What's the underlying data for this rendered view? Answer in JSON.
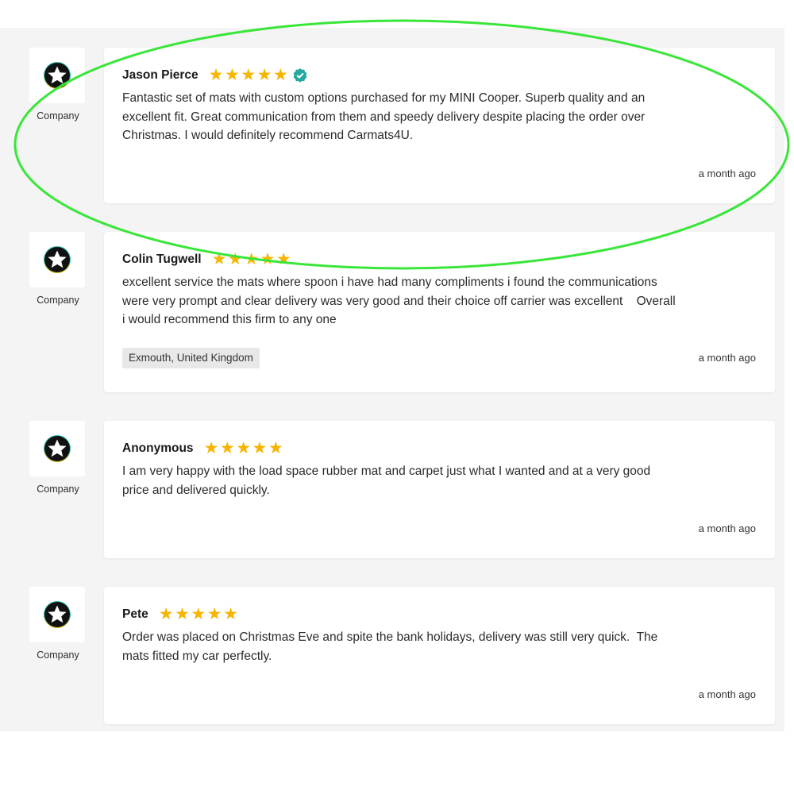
{
  "theme": {
    "star_color": "#f7b500",
    "verified_color": "#25a89e",
    "annotation_color": "#39e639"
  },
  "reviews": [
    {
      "company_label": "Company",
      "author": "Jason Pierce",
      "rating": 5,
      "verified": true,
      "text_lines": [
        "Fantastic set of mats with custom options purchased for my MINI Cooper. Superb quality and an",
        "excellent fit. Great communication from them and speedy delivery despite placing the order over",
        "Christmas. I would definitely recommend Carmats4U."
      ],
      "location": "",
      "date": "a month ago"
    },
    {
      "company_label": "Company",
      "author": "Colin Tugwell",
      "rating": 5,
      "verified": false,
      "text_lines": [
        "excellent service the mats where spoon i have had many compliments i found the communications",
        "were very prompt and clear delivery was very good and their choice off carrier was excellent    Overall",
        "i would recommend this firm to any one"
      ],
      "location": "Exmouth, United Kingdom",
      "date": "a month ago"
    },
    {
      "company_label": "Company",
      "author": "Anonymous",
      "rating": 5,
      "verified": false,
      "text_lines": [
        "I am very happy with the load space rubber mat and carpet just what I wanted and at a very good",
        "price and delivered quickly."
      ],
      "location": "",
      "date": "a month ago"
    },
    {
      "company_label": "Company",
      "author": "Pete",
      "rating": 5,
      "verified": false,
      "text_lines": [
        "Order was placed on Christmas Eve and spite the bank holidays, delivery was still very quick.  The",
        "mats fitted my car perfectly."
      ],
      "location": "",
      "date": "a month ago"
    }
  ]
}
